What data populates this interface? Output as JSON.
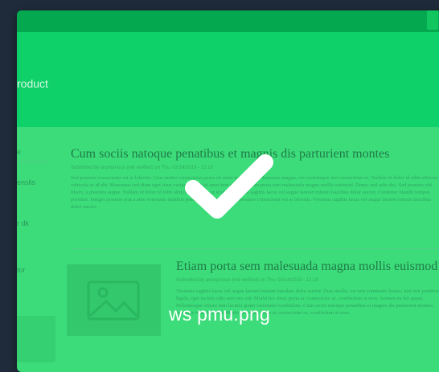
{
  "header": {
    "title": "roduct"
  },
  "sidebar": {
    "items": [
      "e",
      "enslis",
      "e",
      "r dk",
      "",
      "tor"
    ]
  },
  "articles": [
    {
      "title": "Cum sociis natoque penatibus et magnis dis parturient montes",
      "meta": "Submitted by anonymous (not verified) on Thu, 03/14/2019 - 12:18",
      "body": "Sed posuere consectetur est at lobortis. Cras mattis consectetur purus sit amet fermentum. Maecenas magna, vel scelerisque nisl consectetur et. Nullam id dolor id nibh ultricies vehicula ut id elit. Maecenas sed diam eget risus varius blandit sit amet non magna. Etiam porta sem malesuada magna mollis euismod. Donec sed odio dui. Sed posuere elit libero, a pharetra augue. Nullam id dolor id nibh ultricies vehicula ut id elit. Vivamus sagittis lacus vel augue laoreet rutrum faucibus dolor auctor. Curabitur blandit tempus porttitor. Integer posuere erat a ante venenatis dapibus posuere velit aliquet. Sed posuere consectetur est at lobortis. Vivamus sagittis lacus vel augue laoreet rutrum faucibus dolor auctor."
    },
    {
      "title": "Etiam porta sem malesuada magna mollis euismod",
      "meta": "Submitted by anonymous (not verified) on Thu, 03/14/2019 - 12:18",
      "body": "Vivamus sagittis lacus vel augue laoreet rutrum faucibus dolor auctor. Duis mollis, est non commodo luctus, nisi erat porttitor ligula, eget lacinia odio sem nec elit. Morbi leo risus, porta ac consectetur ac, vestibulum at eros. Aenean eu leo quam. Pellentesque ornare sem lacinia quam venenatis vestibulum. Cum sociis natoque penatibus et magnis dis parturient montes, nascetur ridiculus mus. Morbi leo risus, porta ac consectetur ac, vestibulum at eros."
    }
  ],
  "overlay": {
    "filename": "ws pmu.png",
    "icon": "checkmark-icon",
    "color": "#3ddc7a"
  }
}
